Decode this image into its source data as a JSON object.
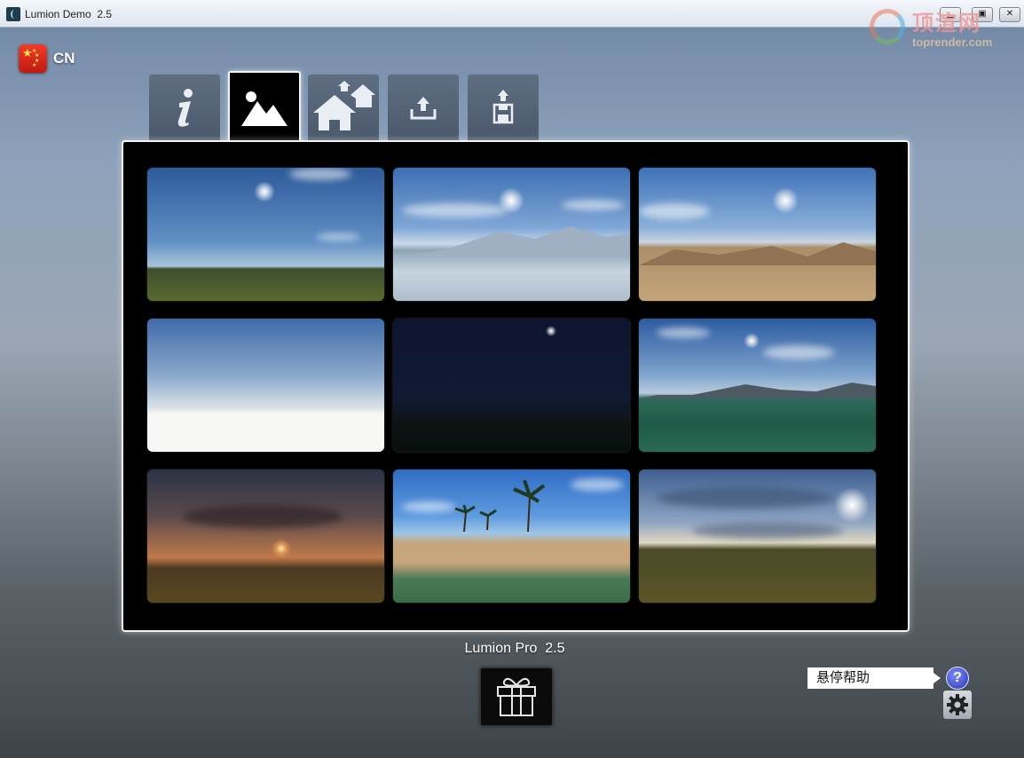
{
  "window": {
    "title": "Lumion Demo  2.5",
    "buttons": [
      "minimize",
      "maximize",
      "close"
    ]
  },
  "watermark": {
    "text_main": "顶渲网",
    "text_sub": "toprender.com"
  },
  "language": {
    "code": "CN",
    "flag": "china-flag-icon"
  },
  "tabs": [
    {
      "name": "info",
      "icon": "info-icon",
      "active": false
    },
    {
      "name": "landscape",
      "icon": "landscape-icon",
      "active": true
    },
    {
      "name": "example-scenes",
      "icon": "houses-icon",
      "active": false
    },
    {
      "name": "import-scene",
      "icon": "upload-icon",
      "active": false
    },
    {
      "name": "load-scene",
      "icon": "save-disk-icon",
      "active": false
    }
  ],
  "landscapes": [
    {
      "id": "grass-plain-blue-sky"
    },
    {
      "id": "snow-mountains"
    },
    {
      "id": "desert"
    },
    {
      "id": "white-horizon"
    },
    {
      "id": "night-sky"
    },
    {
      "id": "ocean-mountains"
    },
    {
      "id": "sunset-plain"
    },
    {
      "id": "tropical-island"
    },
    {
      "id": "cloudy-plain"
    }
  ],
  "footer": {
    "product_label": "Lumion Pro  2.5"
  },
  "help": {
    "hover_help_label": "悬停帮助",
    "help_symbol": "?"
  },
  "colors": {
    "panel_bg": "#000000",
    "tab_bg": "#55657a",
    "accent_help": "#2f3fcc"
  }
}
